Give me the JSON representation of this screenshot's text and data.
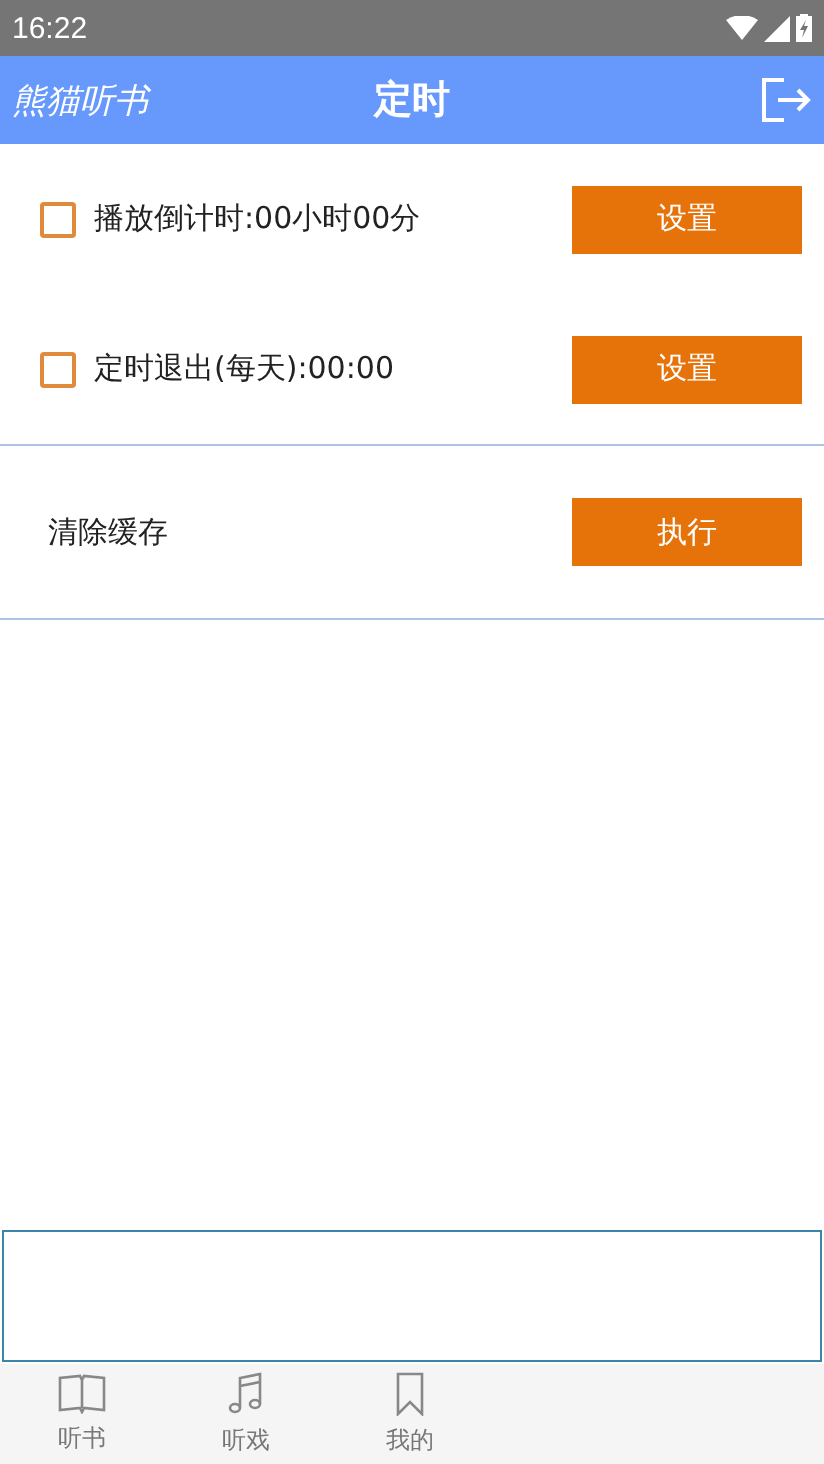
{
  "status_bar": {
    "time": "16:22"
  },
  "header": {
    "app_name": "熊猫听书",
    "title": "定时"
  },
  "settings": [
    {
      "kind": "checkbox",
      "label": "播放倒计时:00小时00分",
      "checked": false,
      "button": "设置"
    },
    {
      "kind": "checkbox",
      "label": "定时退出(每天):00:00",
      "checked": false,
      "button": "设置"
    },
    {
      "kind": "action",
      "label": "清除缓存",
      "button": "执行"
    }
  ],
  "tabs": [
    {
      "label": "听书",
      "kind": "book"
    },
    {
      "label": "听戏",
      "kind": "music"
    },
    {
      "label": "我的",
      "kind": "bookmark"
    }
  ]
}
